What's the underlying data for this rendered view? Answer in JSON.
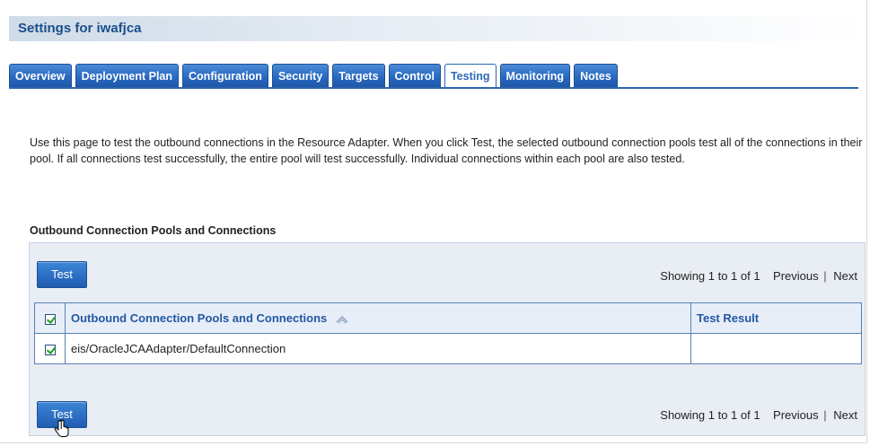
{
  "window": {
    "title": "Settings for iwafjca"
  },
  "tabs": [
    {
      "label": "Overview",
      "active": false
    },
    {
      "label": "Deployment Plan",
      "active": false
    },
    {
      "label": "Configuration",
      "active": false
    },
    {
      "label": "Security",
      "active": false
    },
    {
      "label": "Targets",
      "active": false
    },
    {
      "label": "Control",
      "active": false
    },
    {
      "label": "Testing",
      "active": true
    },
    {
      "label": "Monitoring",
      "active": false
    },
    {
      "label": "Notes",
      "active": false
    }
  ],
  "intro": "Use this page to test the outbound connections in the Resource Adapter. When you click Test, the selected outbound connection pools test all of the connections in their pool. If all connections test successfully, the entire pool will test successfully. Individual connections within each pool are also tested.",
  "section": {
    "title": "Outbound Connection Pools and Connections"
  },
  "toolbar": {
    "test_label": "Test",
    "showing": "Showing 1 to 1 of 1",
    "previous": "Previous",
    "separator": "|",
    "next": "Next"
  },
  "table": {
    "headers": {
      "name": "Outbound Connection Pools and Connections",
      "result": "Test Result"
    },
    "rows": [
      {
        "name": "eis/OracleJCAAdapter/DefaultConnection",
        "result": "",
        "checked": true
      }
    ],
    "header_checked": true
  },
  "icons": {
    "sort": "sort-ascending-icon",
    "cursor": "hand-cursor-icon"
  },
  "colors": {
    "tab_blue": "#2767bf",
    "title_blue": "#1a4f8c",
    "header_text": "#2358a3",
    "check_green": "#1a9a1a"
  }
}
